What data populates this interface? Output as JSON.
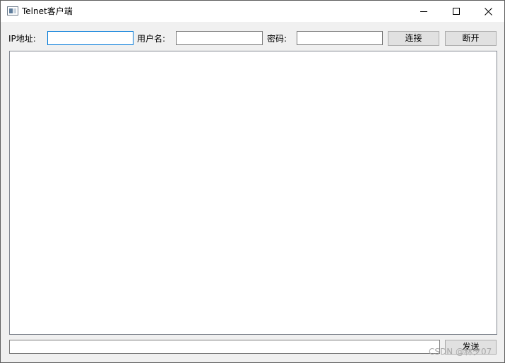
{
  "window": {
    "title": "Telnet客户端",
    "minimize_icon": "minimize-icon",
    "maximize_icon": "maximize-icon",
    "close_icon": "close-icon"
  },
  "connection": {
    "ip_label": "IP地址:",
    "ip_value": "",
    "username_label": "用户名:",
    "username_value": "",
    "password_label": "密码:",
    "password_value": "",
    "connect_label": "连接",
    "disconnect_label": "断开"
  },
  "output": {
    "text": ""
  },
  "send": {
    "input_value": "",
    "button_label": "发送"
  },
  "watermark": "CSDN @林夕07"
}
